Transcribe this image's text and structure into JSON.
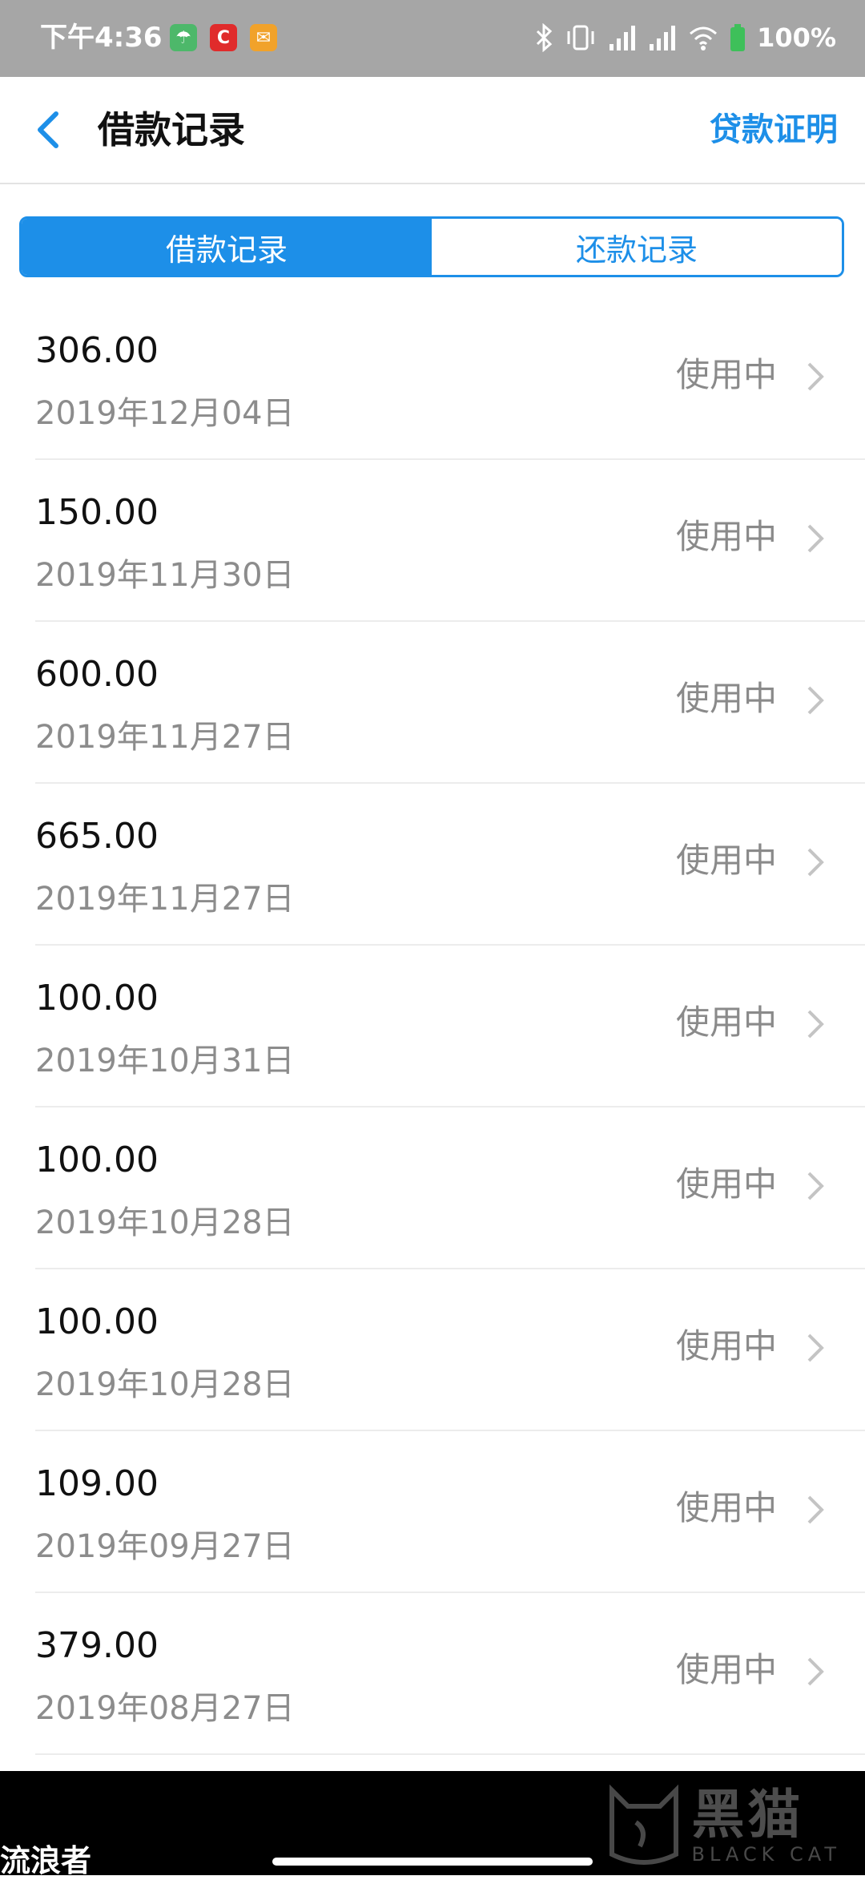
{
  "status_bar": {
    "time": "下午4:36",
    "battery": "100%",
    "apps": [
      {
        "icon": "green-umbrella-app-icon",
        "glyph": "☂",
        "color": "#4db86a"
      },
      {
        "icon": "c-app-icon",
        "glyph": "C",
        "color": "#e02b2b"
      },
      {
        "icon": "mail-app-icon",
        "glyph": "✉",
        "color": "#f1a22a"
      }
    ]
  },
  "header": {
    "title": "借款记录",
    "action": "贷款证明"
  },
  "tabs": [
    {
      "label": "借款记录",
      "active": true
    },
    {
      "label": "还款记录",
      "active": false
    }
  ],
  "records": [
    {
      "amount": "306.00",
      "date": "2019年12月04日",
      "status": "使用中"
    },
    {
      "amount": "150.00",
      "date": "2019年11月30日",
      "status": "使用中"
    },
    {
      "amount": "600.00",
      "date": "2019年11月27日",
      "status": "使用中"
    },
    {
      "amount": "665.00",
      "date": "2019年11月27日",
      "status": "使用中"
    },
    {
      "amount": "100.00",
      "date": "2019年10月31日",
      "status": "使用中"
    },
    {
      "amount": "100.00",
      "date": "2019年10月28日",
      "status": "使用中"
    },
    {
      "amount": "100.00",
      "date": "2019年10月28日",
      "status": "使用中"
    },
    {
      "amount": "109.00",
      "date": "2019年09月27日",
      "status": "使用中"
    },
    {
      "amount": "379.00",
      "date": "2019年08月27日",
      "status": "使用中"
    }
  ],
  "watermarks": {
    "left": "流浪者",
    "right_cn": "黑猫",
    "right_en": "BLACK CAT"
  },
  "colors": {
    "accent": "#1d8fe8",
    "status_bar": "#a6a6a6",
    "secondary_text": "#8c8c8c"
  }
}
